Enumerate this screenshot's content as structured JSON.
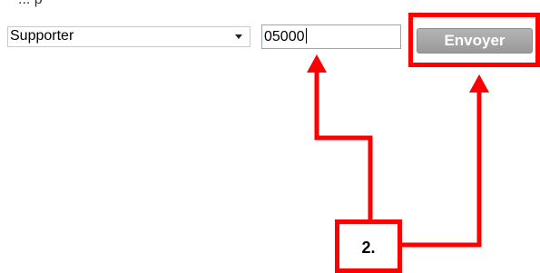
{
  "form": {
    "clipped_top_text": "... p",
    "select_value": "Supporter",
    "postal_code_value": "05000",
    "submit_label": "Envoyer"
  },
  "annotation": {
    "step_label": "2.",
    "color": "#ff0000"
  }
}
